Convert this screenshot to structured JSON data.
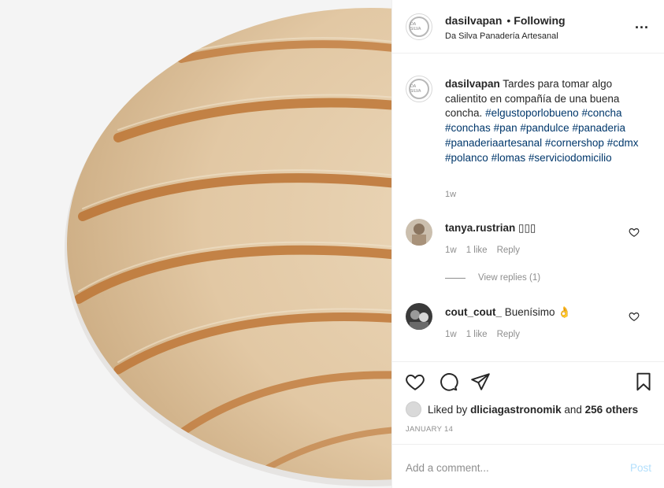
{
  "header": {
    "username": "dasilvapan",
    "separator": "•",
    "follow_status": "Following",
    "location": "Da Silva Panadería Artesanal",
    "more_label": "..."
  },
  "caption": {
    "username": "dasilvapan",
    "text": "Tardes para tomar algo calientito en compañía de una buena concha.",
    "hashtags": [
      "#elgustoporlobueno",
      "#concha",
      "#conchas",
      "#pan",
      "#pandulce",
      "#panaderia",
      "#panaderiaartesanal",
      "#cornershop",
      "#cdmx",
      "#polanco",
      "#lomas",
      "#serviciodomicilio"
    ],
    "time": "1w"
  },
  "comments": [
    {
      "username": "tanya.rustrian",
      "text": "▯▯▯",
      "time": "1w",
      "likes": "1 like",
      "reply": "Reply",
      "view_replies": "View replies (1)"
    },
    {
      "username": "cout_cout_",
      "text": "Buenísimo 👌",
      "time": "1w",
      "likes": "1 like",
      "reply": "Reply"
    }
  ],
  "actions": {
    "liked_by_prefix": "Liked by",
    "liked_by_user": "dliciagastronomik",
    "liked_by_suffix": "and",
    "others": "256 others",
    "date": "JANUARY 14"
  },
  "add_comment": {
    "placeholder": "Add a comment...",
    "post_label": "Post"
  },
  "avatar_text": "DA SILVA",
  "colors": {
    "hashtag": "#00376b",
    "secondary_text": "#8e8e8e",
    "post_disabled": "#b2dffc"
  },
  "icons": [
    "more-icon",
    "heart-icon",
    "comment-icon",
    "share-icon",
    "bookmark-icon"
  ]
}
